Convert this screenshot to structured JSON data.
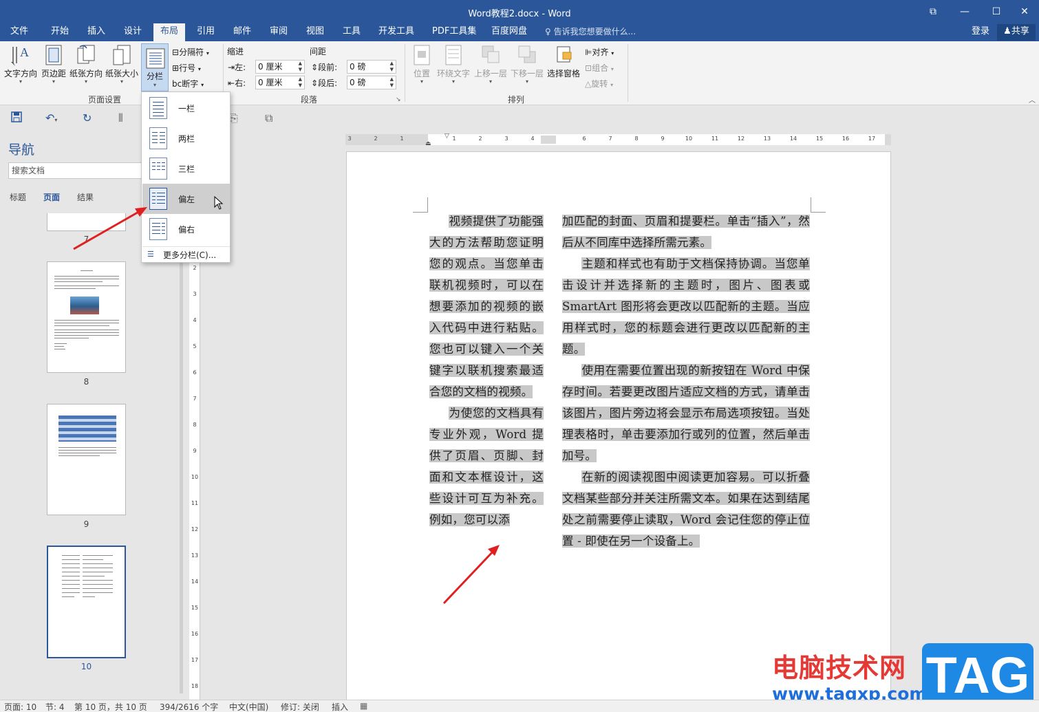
{
  "window": {
    "title": "Word教程2.docx - Word",
    "buttons": [
      "⧉",
      "—",
      "☐",
      "✕"
    ]
  },
  "tabs": [
    "文件",
    "开始",
    "插入",
    "设计",
    "布局",
    "引用",
    "邮件",
    "审阅",
    "视图",
    "工具",
    "开发工具",
    "PDF工具集",
    "百度网盘"
  ],
  "active_tab": "布局",
  "tellme": "告诉我您想要做什么...",
  "signin": "登录",
  "share": "共享",
  "ribbon": {
    "page_setup": {
      "label": "页面设置",
      "text_direction": "文字方向",
      "margins": "页边距",
      "orientation": "纸张方向",
      "size": "纸张大小",
      "columns": "分栏",
      "breaks": "分隔符",
      "line_numbers": "行号",
      "hyphenation": "断字"
    },
    "paragraph": {
      "label": "段落",
      "indent_header": "缩进",
      "spacing_header": "间距",
      "left_label": "左:",
      "left_value": "0 厘米",
      "right_label": "右:",
      "right_value": "0 厘米",
      "before_label": "段前:",
      "before_value": "0 磅",
      "after_label": "段后:",
      "after_value": "0 磅"
    },
    "arrange": {
      "label": "排列",
      "position": "位置",
      "wrap_text": "环绕文字",
      "bring_forward": "上移一层",
      "send_backward": "下移一层",
      "selection_pane": "选择窗格",
      "align": "对齐",
      "group": "组合",
      "rotate": "旋转"
    }
  },
  "columns_menu": {
    "items": [
      "一栏",
      "两栏",
      "三栏",
      "偏左",
      "偏右"
    ],
    "hovered": "偏左",
    "more": "更多分栏(C)..."
  },
  "nav": {
    "title": "导航",
    "search_placeholder": "搜索文档",
    "tabs": [
      "标题",
      "页面",
      "结果"
    ],
    "active_tab": "页面",
    "pages": [
      "7",
      "8",
      "9",
      "10"
    ],
    "selected_page": "10"
  },
  "ruler": {
    "h_left": [
      "3",
      "2",
      "1"
    ],
    "h_right": [
      "1",
      "2",
      "3",
      "4",
      "6",
      "7",
      "8",
      "9",
      "10",
      "11",
      "12",
      "13",
      "14",
      "15",
      "16",
      "17"
    ],
    "v": [
      "1",
      "2",
      "3",
      "4",
      "5",
      "6",
      "7",
      "8",
      "9",
      "10",
      "11",
      "12",
      "13",
      "14",
      "15",
      "16",
      "17",
      "18"
    ]
  },
  "document": {
    "left_column": [
      "视频提供了功能强大的方法帮助您证明您的观点。当您单击联机视频时，可以在想要添加的视频的嵌入代码中进行粘贴。您也可以键入一个关键字以联机搜索最适合您的文档的视频。",
      "为使您的文档具有专业外观，Word 提供了页眉、页脚、封面和文本框设计，这些设计可互为补充。例如，您可以添"
    ],
    "right_column": [
      "加匹配的封面、页眉和提要栏。单击“插入”，然后从不同库中选择所需元素。",
      "主题和样式也有助于文档保持协调。当您单击设计并选择新的主题时，图片、图表或 SmartArt 图形将会更改以匹配新的主题。当应用样式时，您的标题会进行更改以匹配新的主题。",
      "使用在需要位置出现的新按钮在 Word 中保存时间。若要更改图片适应文档的方式，请单击该图片，图片旁边将会显示布局选项按钮。当处理表格时，单击要添加行或列的位置，然后单击加号。",
      "在新的阅读视图中阅读更加容易。可以折叠文档某些部分并关注所需文本。如果在达到结尾处之前需要停止读取，Word 会记住您的停止位置 - 即使在另一个设备上。"
    ]
  },
  "status": {
    "page": "页面: 10",
    "section": "节: 4",
    "page_of": "第 10 页，共 10 页",
    "words": "394/2616 个字",
    "language": "中文(中国)",
    "track": "修订: 关闭",
    "mode": "插入"
  },
  "watermark": {
    "site_cn": "电脑技术网",
    "url": "www.tagxp.com",
    "tag": "TAG"
  },
  "colors": {
    "accent": "#2b579a",
    "highlight": "#c8c8c8",
    "arrow": "#e02020"
  }
}
